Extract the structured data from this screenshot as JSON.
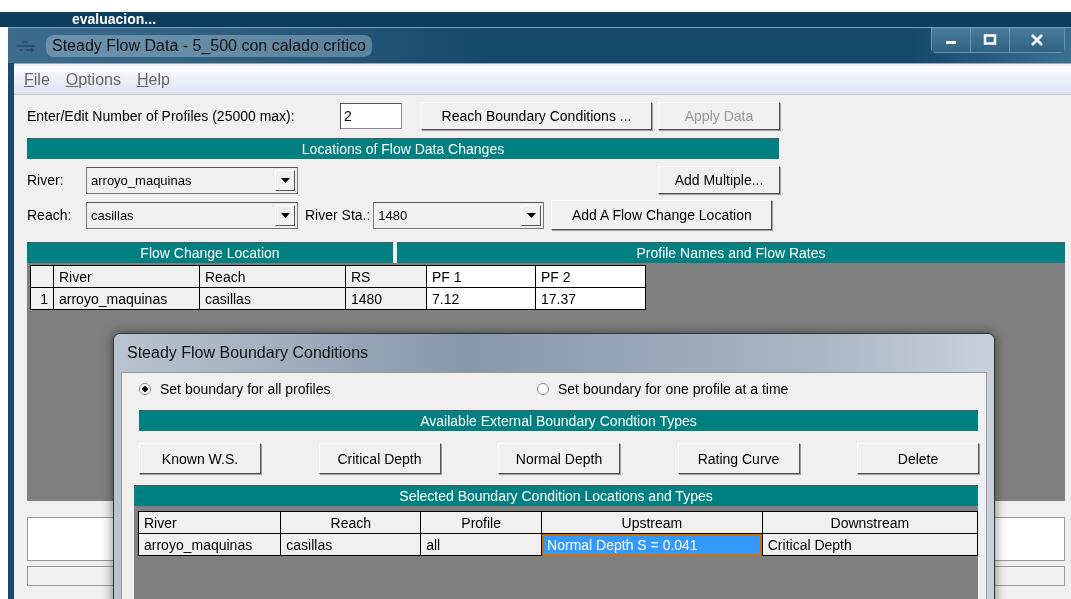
{
  "background_window": {
    "title": "evaluacion..."
  },
  "window": {
    "title": "Steady Flow Data - 5_500 con calado crítico"
  },
  "menu": [
    {
      "label": "File"
    },
    {
      "label": "Options"
    },
    {
      "label": "Help"
    }
  ],
  "profiles": {
    "label": "Enter/Edit Number of Profiles (25000 max):",
    "value": "2"
  },
  "top_buttons": [
    {
      "label": "Reach Boundary Conditions ...",
      "disabled": false
    },
    {
      "label": "Apply Data",
      "disabled": true
    }
  ],
  "locations": {
    "title": "Locations of Flow Data Changes",
    "river": {
      "label": "River:",
      "value": "arroyo_maquinas"
    },
    "reach": {
      "label": "Reach:",
      "value": "casillas"
    },
    "river_station": {
      "label": "River Sta.:",
      "value": "1480"
    },
    "add_multiple": "Add Multiple...",
    "add_location": "Add A Flow Change Location"
  },
  "flow_table": {
    "left_title": "Flow Change Location",
    "right_title": "Profile Names and Flow Rates",
    "columns": [
      {
        "label": "River",
        "editable": false
      },
      {
        "label": "Reach",
        "editable": false
      },
      {
        "label": "RS",
        "editable": false
      },
      {
        "label": "PF 1",
        "editable": true
      },
      {
        "label": "PF 2",
        "editable": true
      }
    ],
    "rows": [
      {
        "number": "1",
        "cells": [
          "arroyo_maquinas",
          "casillas",
          "1480",
          "7.12",
          "17.37"
        ]
      }
    ]
  },
  "dialog": {
    "title": "Steady Flow Boundary Conditions",
    "modes": [
      {
        "label": "Set boundary for all profiles",
        "selected": true
      },
      {
        "label": "Set boundary for one profile at a time",
        "selected": false
      }
    ],
    "types_title": "Available External Boundary Condtion Types",
    "types": [
      "Known W.S.",
      "Critical Depth",
      "Normal Depth",
      "Rating Curve",
      "Delete"
    ],
    "selected_title": "Selected Boundary Condition Locations and Types",
    "columns": [
      "River",
      "Reach",
      "Profile",
      "Upstream",
      "Downstream"
    ],
    "rows": [
      {
        "cells": [
          {
            "text": "arroyo_maquinas",
            "selected": false
          },
          {
            "text": "casillas",
            "selected": false
          },
          {
            "text": "all",
            "selected": false
          },
          {
            "text": "Normal Depth S = 0.041",
            "selected": true
          },
          {
            "text": "Critical Depth",
            "selected": false
          }
        ]
      }
    ]
  }
}
